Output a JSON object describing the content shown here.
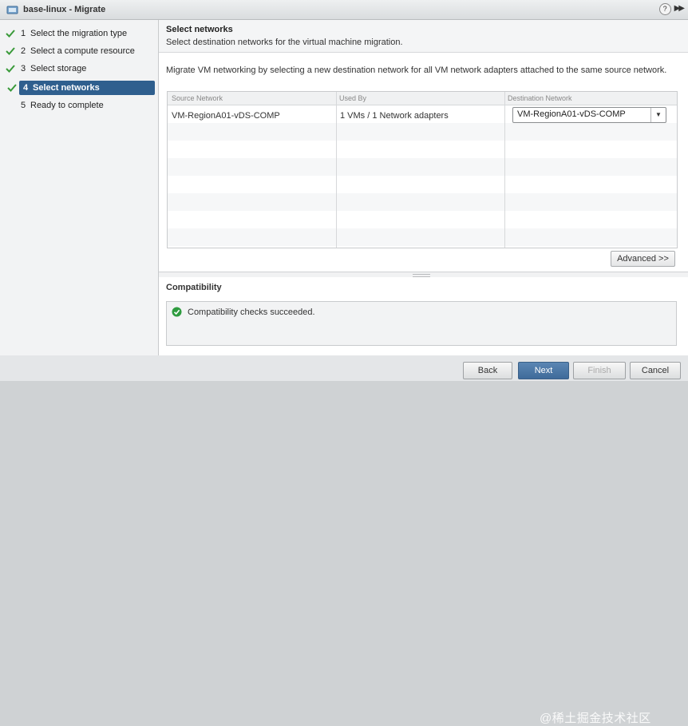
{
  "window": {
    "title": "base-linux - Migrate"
  },
  "sidebar": {
    "steps": [
      {
        "num": "1",
        "label": "Select the migration type",
        "done": true
      },
      {
        "num": "2",
        "label": "Select a compute resource",
        "done": true
      },
      {
        "num": "3",
        "label": "Select storage",
        "done": true
      },
      {
        "num": "4",
        "label": "Select networks",
        "done": true,
        "active": true
      },
      {
        "num": "5",
        "label": "Ready to complete",
        "done": false
      }
    ]
  },
  "header": {
    "title": "Select networks",
    "subtitle": "Select destination networks for the virtual machine migration."
  },
  "description": "Migrate VM networking by selecting a new destination network for all VM network adapters attached to the same source network.",
  "grid": {
    "columns": [
      "Source Network",
      "Used By",
      "Destination Network"
    ],
    "rows": [
      {
        "source": "VM-RegionA01-vDS-COMP",
        "used_by": "1 VMs / 1 Network adapters",
        "destination": "VM-RegionA01-vDS-COMP"
      }
    ]
  },
  "advanced_label": "Advanced >>",
  "compatibility": {
    "label": "Compatibility",
    "message": "Compatibility checks succeeded."
  },
  "footer": {
    "back": "Back",
    "next": "Next",
    "finish": "Finish",
    "cancel": "Cancel"
  },
  "watermark": "@稀土掘金技术社区",
  "colors": {
    "accent": "#2f5f8e",
    "check": "#3a9a3a",
    "ok": "#2e9b3f"
  }
}
